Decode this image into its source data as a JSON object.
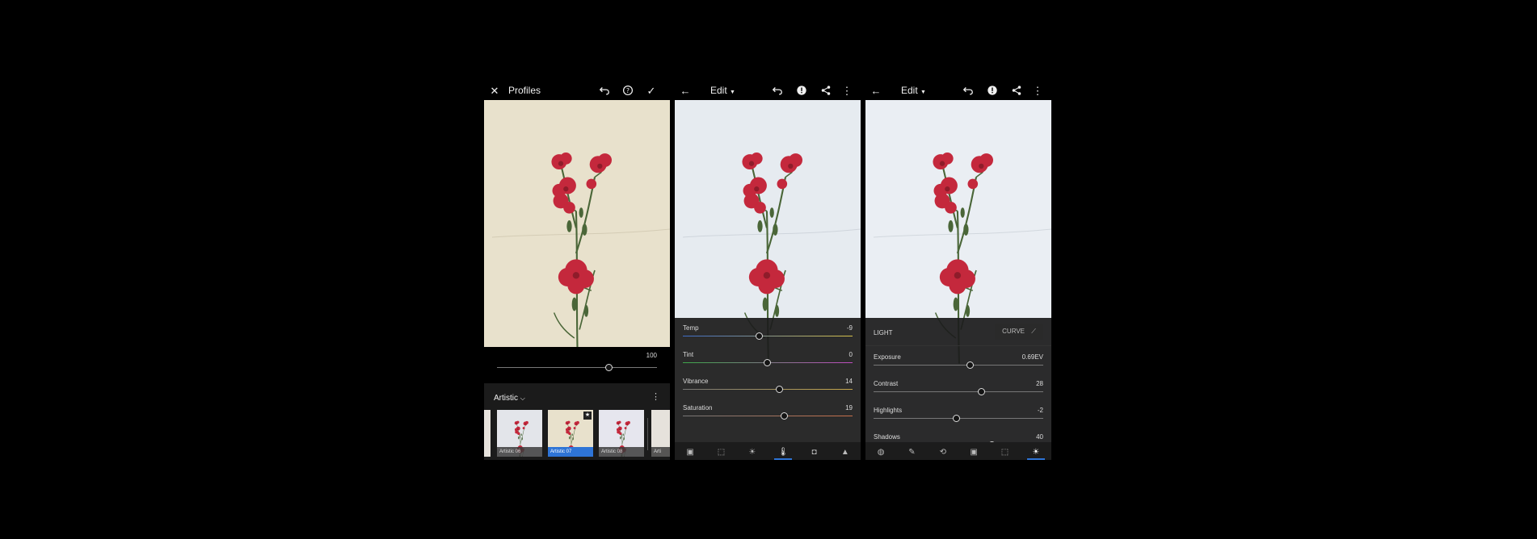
{
  "panel1": {
    "title": "Profiles",
    "amount_value": "100",
    "amount_fraction": 0.7,
    "category": "Artistic",
    "thumbnails": [
      {
        "label": "Artistic 06",
        "selected": false,
        "favorite": false
      },
      {
        "label": "Artistic 07",
        "selected": true,
        "favorite": true
      },
      {
        "label": "Artistic 08",
        "selected": false,
        "favorite": false
      },
      {
        "label": "Arti",
        "selected": false,
        "favorite": false
      }
    ],
    "icons": [
      "close-icon",
      "undo-icon",
      "help-icon",
      "check-icon"
    ]
  },
  "panel2": {
    "title": "Edit",
    "sliders": [
      {
        "label": "Temp",
        "value": "-9",
        "fraction": 0.45,
        "gradient": "linear-gradient(90deg,#3d6cc8,#d7c24a)"
      },
      {
        "label": "Tint",
        "value": "0",
        "fraction": 0.5,
        "gradient": "linear-gradient(90deg,#3da84a,#c04cc0)"
      },
      {
        "label": "Vibrance",
        "value": "14",
        "fraction": 0.57,
        "gradient": "linear-gradient(90deg,#777,#c8a84a)"
      },
      {
        "label": "Saturation",
        "value": "19",
        "fraction": 0.6,
        "gradient": "linear-gradient(90deg,#777,#c8704a)"
      }
    ],
    "icons": [
      "back-arrow-icon",
      "undo-icon",
      "alert-icon",
      "share-icon",
      "more-vertical-icon"
    ],
    "bottom_icons": [
      "presets-icon",
      "auto-icon",
      "light-icon",
      "color-icon",
      "effects-icon",
      "detail-icon"
    ],
    "active_tool": 3
  },
  "panel3": {
    "title": "Edit",
    "section": "LIGHT",
    "curve_label": "CURVE",
    "sliders": [
      {
        "label": "Exposure",
        "value": "0.69EV",
        "fraction": 0.57
      },
      {
        "label": "Contrast",
        "value": "28",
        "fraction": 0.64
      },
      {
        "label": "Highlights",
        "value": "-2",
        "fraction": 0.49
      },
      {
        "label": "Shadows",
        "value": "40",
        "fraction": 0.7
      }
    ],
    "icons": [
      "back-arrow-icon",
      "undo-icon",
      "alert-icon",
      "share-icon",
      "more-vertical-icon"
    ],
    "bottom_icons": [
      "selective-icon",
      "healing-icon",
      "crop-icon",
      "presets-icon",
      "auto-icon",
      "light-icon"
    ],
    "active_tool": 5
  },
  "colors": {
    "accent": "#2e74d6",
    "warm_wall": "#e8e1cc",
    "cool_wall": "#e6ebf0",
    "petal": "#c4283c",
    "stem": "#4d6a3a"
  }
}
